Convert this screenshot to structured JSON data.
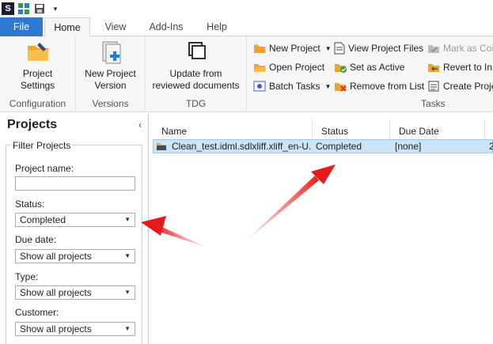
{
  "quick_access": {
    "logo_letter": "S",
    "icons": [
      "app-logo-icon",
      "puzzle-icon",
      "save-icon",
      "customize-dropdown-icon"
    ]
  },
  "tabs": [
    {
      "label": "File"
    },
    {
      "label": "Home"
    },
    {
      "label": "View"
    },
    {
      "label": "Add-Ins"
    },
    {
      "label": "Help"
    }
  ],
  "ribbon": {
    "groups": {
      "configuration": {
        "label": "Configuration",
        "project_settings": "Project\nSettings"
      },
      "versions": {
        "label": "Versions",
        "new_project_version": "New Project\nVersion"
      },
      "tdg": {
        "label": "TDG",
        "update_from_reviewed": "Update from\nreviewed documents"
      },
      "tasks": {
        "label": "Tasks",
        "new_project": "New Project",
        "open_project": "Open Project",
        "batch_tasks": "Batch Tasks",
        "view_project_files": "View Project Files",
        "set_as_active": "Set as Active",
        "remove_from_list": "Remove from List",
        "mark_as_complete": "Mark as Cor",
        "revert_to": "Revert to In",
        "create_project": "Create Proje"
      }
    }
  },
  "left_panel": {
    "title": "Projects",
    "collapse_glyph": "‹",
    "filter_legend": "Filter Projects",
    "project_name_label": "Project name:",
    "project_name_value": "",
    "status_label": "Status:",
    "status_value": "Completed",
    "due_date_label": "Due date:",
    "due_date_value": "Show all projects",
    "type_label": "Type:",
    "type_value": "Show all projects",
    "customer_label": "Customer:",
    "customer_value": "Show all projects"
  },
  "grid": {
    "columns": [
      "Name",
      "Status",
      "Due Date"
    ],
    "rows": [
      {
        "name": "Clean_test.idml.sdlxliff.xliff_en-U...",
        "status": "Completed",
        "due_date": "[none]",
        "extra": "2"
      }
    ]
  },
  "colors": {
    "file_tab": "#2b79d0",
    "selection": "#cce4f7",
    "annotation_arrow": "#e51b1b"
  }
}
